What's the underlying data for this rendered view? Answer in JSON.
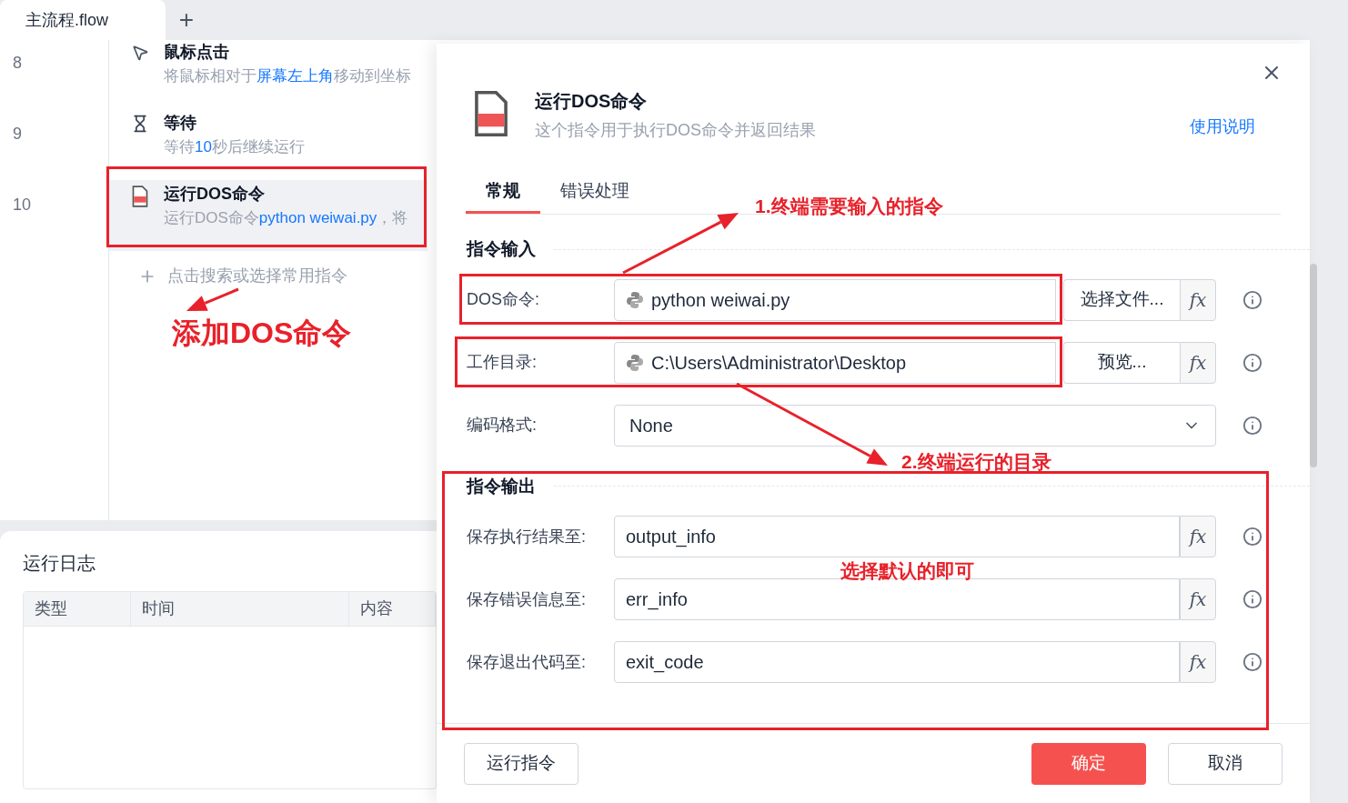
{
  "tabs": [
    {
      "label": "主流程.flow",
      "selected": true
    }
  ],
  "add_tab": "+",
  "flow": {
    "steps": [
      {
        "line": "8",
        "kind": "cursor",
        "title": "鼠标点击",
        "selected": false,
        "desc": [
          {
            "kind": "text",
            "text": "将鼠标相对于"
          },
          {
            "kind": "param",
            "text": "屏幕左上角"
          },
          {
            "kind": "text",
            "text": "移动到坐标"
          }
        ]
      },
      {
        "line": "9",
        "kind": "hourglass",
        "title": "等待",
        "selected": false,
        "desc": [
          {
            "kind": "text",
            "text": "等待"
          },
          {
            "kind": "param",
            "text": "10"
          },
          {
            "kind": "text",
            "text": "秒后继续运行"
          }
        ]
      },
      {
        "line": "10",
        "kind": "dos",
        "title": "运行DOS命令",
        "selected": true,
        "desc": [
          {
            "kind": "text",
            "text": "运行DOS命令"
          },
          {
            "kind": "param",
            "text": "python weiwai.py"
          },
          {
            "kind": "text",
            "text": "，将"
          }
        ]
      }
    ],
    "add_hint": "点击搜索或选择常用指令"
  },
  "log": {
    "title": "运行日志",
    "columns": [
      "类型",
      "时间",
      "内容"
    ]
  },
  "dialog": {
    "title": "运行DOS命令",
    "subtitle": "这个指令用于执行DOS命令并返回结果",
    "help_link": "使用说明",
    "tabs": [
      {
        "label": "常规",
        "selected": true
      },
      {
        "label": "错误处理",
        "selected": false
      }
    ],
    "sections": [
      {
        "title": "指令输入",
        "fields": [
          {
            "kind": "script_input",
            "label": "DOS命令:",
            "value": "python weiwai.py",
            "button": "选择文件...",
            "fx": "fx"
          },
          {
            "kind": "script_input",
            "label": "工作目录:",
            "value": "C:\\Users\\Administrator\\Desktop",
            "button": "预览...",
            "fx": "fx"
          },
          {
            "kind": "select",
            "label": "编码格式:",
            "value": "None"
          }
        ]
      },
      {
        "title": "指令输出",
        "fields": [
          {
            "kind": "input",
            "label": "保存执行结果至:",
            "value": "output_info",
            "fx": "fx"
          },
          {
            "kind": "input",
            "label": "保存错误信息至:",
            "value": "err_info",
            "fx": "fx"
          },
          {
            "kind": "input",
            "label": "保存退出代码至:",
            "value": "exit_code",
            "fx": "fx"
          }
        ]
      }
    ],
    "footer": [
      {
        "kind": "secondary",
        "label": "运行指令"
      },
      {
        "kind": "primary",
        "label": "确定"
      },
      {
        "kind": "secondary",
        "label": "取消"
      }
    ]
  },
  "annotations": [
    "添加DOS命令",
    "1.终端需要输入的指令",
    "2.终端运行的目录",
    "选择默认的即可"
  ]
}
